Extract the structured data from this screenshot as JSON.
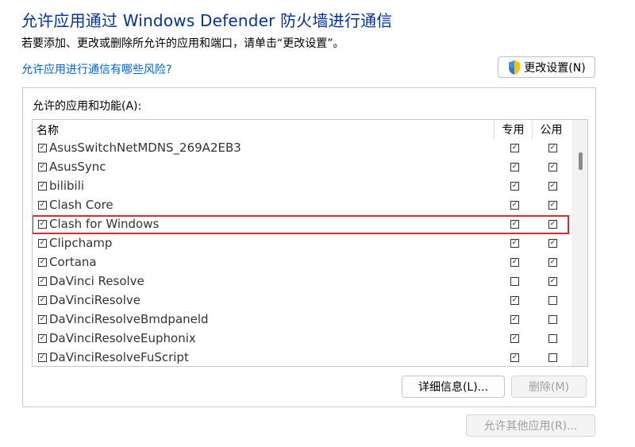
{
  "header": {
    "title": "允许应用通过 Windows Defender 防火墙进行通信",
    "subtitle": "若要添加、更改或删除所允许的应用和端口，请单击“更改设置”。",
    "risk_link": "允许应用进行通信有哪些风险?",
    "change_settings_label": "更改设置(N)"
  },
  "group": {
    "label": "允许的应用和功能(A):",
    "columns": {
      "name": "名称",
      "private": "专用",
      "public": "公用"
    },
    "rows": [
      {
        "name": "AsusSwitchNetMDNS_269A2EB3",
        "enabled": true,
        "private": true,
        "public": true,
        "highlighted": false
      },
      {
        "name": "AsusSync",
        "enabled": true,
        "private": true,
        "public": true,
        "highlighted": false
      },
      {
        "name": "bilibili",
        "enabled": true,
        "private": true,
        "public": true,
        "highlighted": false
      },
      {
        "name": "Clash Core",
        "enabled": true,
        "private": true,
        "public": true,
        "highlighted": false
      },
      {
        "name": "Clash for Windows",
        "enabled": true,
        "private": true,
        "public": true,
        "highlighted": true
      },
      {
        "name": "Clipchamp",
        "enabled": true,
        "private": true,
        "public": true,
        "highlighted": false
      },
      {
        "name": "Cortana",
        "enabled": true,
        "private": true,
        "public": true,
        "highlighted": false
      },
      {
        "name": "DaVinci Resolve",
        "enabled": true,
        "private": false,
        "public": true,
        "highlighted": false
      },
      {
        "name": "DaVinciResolve",
        "enabled": true,
        "private": true,
        "public": false,
        "highlighted": false
      },
      {
        "name": "DaVinciResolveBmdpaneld",
        "enabled": true,
        "private": true,
        "public": false,
        "highlighted": false
      },
      {
        "name": "DaVinciResolveEuphonix",
        "enabled": true,
        "private": true,
        "public": false,
        "highlighted": false
      },
      {
        "name": "DaVinciResolveFuScript",
        "enabled": true,
        "private": true,
        "public": false,
        "highlighted": false
      }
    ],
    "details_label": "详细信息(L)...",
    "remove_label": "删除(M)"
  },
  "footer": {
    "allow_other_label": "允许其他应用(R)..."
  },
  "colors": {
    "title": "#003399",
    "link": "#0066cc",
    "highlight": "#d42d2d",
    "disabled_text": "#a0a0a0"
  },
  "icons": {
    "change_settings": "uac-shield-icon",
    "checkbox_checked": "checkmark"
  }
}
